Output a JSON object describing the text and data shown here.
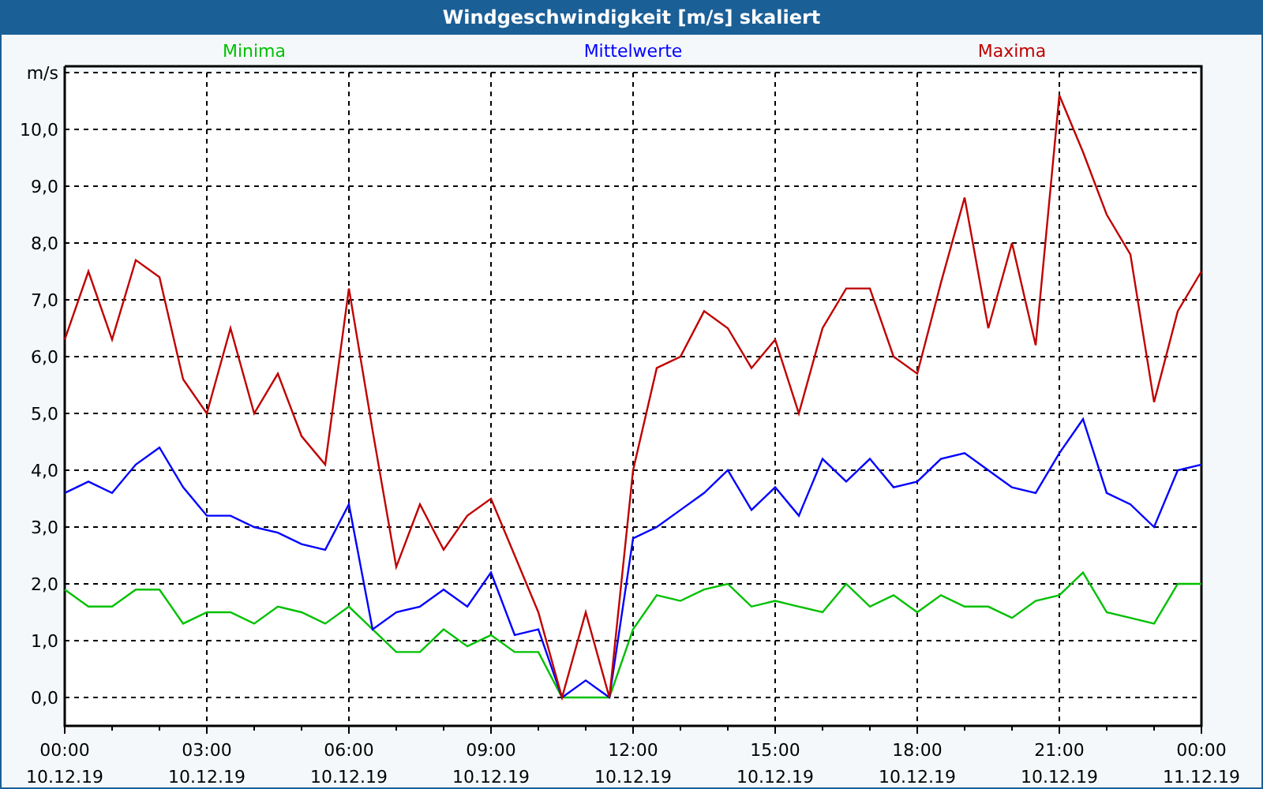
{
  "window": {
    "title": "Windgeschwindigkeit [m/s] skaliert"
  },
  "chart": {
    "chart_data": {
      "type": "line",
      "grid": true,
      "ylabel": "m/s",
      "categories": [
        "00:00 10.12.19",
        null,
        null,
        null,
        null,
        null,
        "03:00 10.12.19",
        null,
        null,
        null,
        null,
        null,
        "06:00 10.12.19",
        null,
        null,
        null,
        null,
        null,
        "09:00 10.12.19",
        null,
        null,
        null,
        null,
        null,
        "12:00 10.12.19",
        null,
        null,
        null,
        null,
        null,
        "15:00 10.12.19",
        null,
        null,
        null,
        null,
        null,
        "18:00 10.12.19",
        null,
        null,
        null,
        null,
        null,
        "21:00 10.12.19",
        null,
        null,
        null,
        null,
        null,
        "00:00 11.12.19"
      ],
      "series": [
        {
          "name": "Minima",
          "color": "#00c000",
          "values": [
            1.9,
            1.6,
            1.6,
            1.9,
            1.9,
            1.3,
            1.5,
            1.5,
            1.3,
            1.6,
            1.5,
            1.3,
            1.6,
            1.2,
            0.8,
            0.8,
            1.2,
            0.9,
            1.1,
            0.8,
            0.8,
            0,
            0,
            0,
            1.2,
            1.8,
            1.7,
            1.9,
            2.0,
            1.6,
            1.7,
            1.6,
            1.5,
            2.0,
            1.6,
            1.8,
            1.5,
            1.8,
            1.6,
            1.6,
            1.4,
            1.7,
            1.8,
            2.2,
            1.5,
            1.4,
            1.3,
            2.0,
            2.0
          ]
        },
        {
          "name": "Mittelwerte",
          "color": "#0000ff",
          "values": [
            3.6,
            3.8,
            3.6,
            4.1,
            4.4,
            3.7,
            3.2,
            3.2,
            3.0,
            2.9,
            2.7,
            2.6,
            3.4,
            1.2,
            1.5,
            1.6,
            1.9,
            1.6,
            2.2,
            1.1,
            1.2,
            0,
            0.3,
            0,
            2.8,
            3.0,
            3.3,
            3.6,
            4.0,
            3.3,
            3.7,
            3.2,
            4.2,
            3.8,
            4.2,
            3.7,
            3.8,
            4.2,
            4.3,
            4.0,
            3.7,
            3.6,
            4.3,
            4.9,
            3.6,
            3.4,
            3.0,
            4.0,
            4.1
          ]
        },
        {
          "name": "Maxima",
          "color": "#c00000",
          "values": [
            6.3,
            7.5,
            6.3,
            7.7,
            7.4,
            5.6,
            5.0,
            6.5,
            5.0,
            5.7,
            4.6,
            4.1,
            7.2,
            4.7,
            2.3,
            3.4,
            2.6,
            3.2,
            3.5,
            2.5,
            1.5,
            0,
            1.5,
            0,
            4.0,
            5.8,
            6.0,
            6.8,
            6.5,
            5.8,
            6.3,
            5.0,
            6.5,
            7.2,
            7.2,
            6.0,
            5.7,
            7.3,
            8.8,
            6.5,
            8.0,
            6.2,
            10.6,
            9.6,
            8.5,
            7.8,
            5.2,
            6.8,
            7.5
          ]
        }
      ],
      "ylim": [
        -0.5,
        11
      ],
      "yticks": [
        {
          "value": 0,
          "label": "0,0"
        },
        {
          "value": 1,
          "label": "1,0"
        },
        {
          "value": 2,
          "label": "2,0"
        },
        {
          "value": 3,
          "label": "3,0"
        },
        {
          "value": 4,
          "label": "4,0"
        },
        {
          "value": 5,
          "label": "5,0"
        },
        {
          "value": 6,
          "label": "6,0"
        },
        {
          "value": 7,
          "label": "7,0"
        },
        {
          "value": 8,
          "label": "8,0"
        },
        {
          "value": 9,
          "label": "9,0"
        },
        {
          "value": 10,
          "label": "10,0"
        }
      ]
    }
  }
}
